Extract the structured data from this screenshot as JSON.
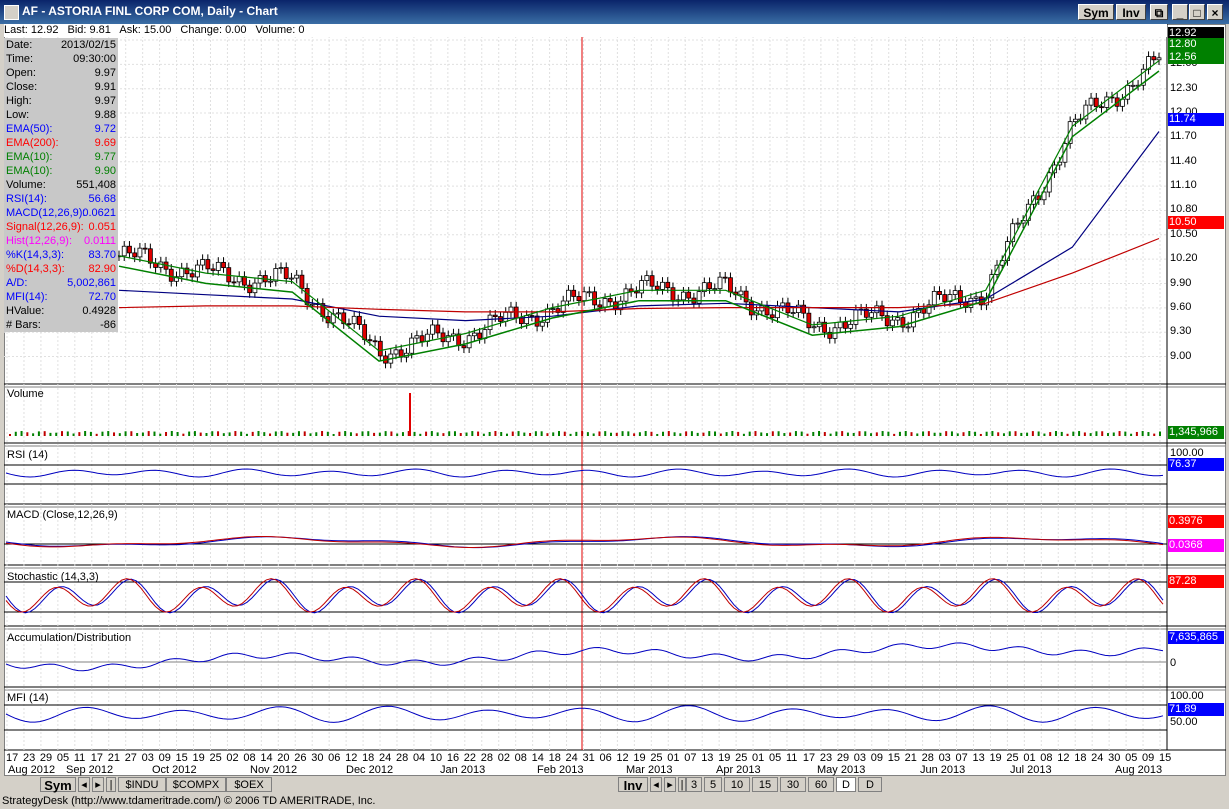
{
  "window": {
    "title": "AF - ASTORIA FINL CORP COM, Daily - Chart",
    "sym_label": "Sym",
    "inv_label": "Inv"
  },
  "header": {
    "last": "Last: 12.92",
    "bid": "Bid: 9.81",
    "ask": "Ask: 15.00",
    "change": "Change: 0.00",
    "volume": "Volume: 0"
  },
  "info_panel": [
    {
      "label": "Date:",
      "value": "2013/02/15",
      "color": "#000000"
    },
    {
      "label": "Time:",
      "value": "09:30:00",
      "color": "#000000"
    },
    {
      "label": "Open:",
      "value": "9.97",
      "color": "#000000"
    },
    {
      "label": "Close:",
      "value": "9.91",
      "color": "#000000"
    },
    {
      "label": "High:",
      "value": "9.97",
      "color": "#000000"
    },
    {
      "label": "Low:",
      "value": "9.88",
      "color": "#000000"
    },
    {
      "label": "EMA(50):",
      "value": "9.72",
      "color": "#0000ff"
    },
    {
      "label": "EMA(200):",
      "value": "9.69",
      "color": "#ff0000"
    },
    {
      "label": "EMA(10):",
      "value": "9.77",
      "color": "#008000"
    },
    {
      "label": "EMA(10):",
      "value": "9.90",
      "color": "#008000"
    },
    {
      "label": "Volume:",
      "value": "551,408",
      "color": "#000000"
    },
    {
      "label": "RSI(14):",
      "value": "56.68",
      "color": "#0000ff"
    },
    {
      "label": "MACD(12,26,9):",
      "value": "0.0621",
      "color": "#0000ff"
    },
    {
      "label": "Signal(12,26,9):",
      "value": "0.051",
      "color": "#ff0000"
    },
    {
      "label": "Hist(12,26,9):",
      "value": "0.0111",
      "color": "#ff00ff"
    },
    {
      "label": "%K(14,3,3):",
      "value": "83.70",
      "color": "#0000ff"
    },
    {
      "label": "%D(14,3,3):",
      "value": "82.90",
      "color": "#ff0000"
    },
    {
      "label": "A/D:",
      "value": "5,002,861",
      "color": "#0000ff"
    },
    {
      "label": "MFI(14):",
      "value": "72.70",
      "color": "#0000ff"
    },
    {
      "label": "HValue:",
      "value": "0.4928",
      "color": "#000000"
    },
    {
      "label": "# Bars:",
      "value": "-86",
      "color": "#000000"
    }
  ],
  "price_axis": {
    "ticks": [
      "12.90",
      "12.60",
      "12.30",
      "12.00",
      "11.70",
      "11.40",
      "11.10",
      "10.80",
      "10.50",
      "10.20",
      "9.90",
      "9.60",
      "9.30",
      "9.00"
    ],
    "tags": [
      {
        "text": "12.92",
        "bg": "#000000",
        "fg": "#ffffff"
      },
      {
        "text": "12.80",
        "bg": "#008000",
        "fg": "#ffffff"
      },
      {
        "text": "12.56",
        "bg": "#008000",
        "fg": "#ffffff"
      },
      {
        "text": "11.74",
        "bg": "#0000ff",
        "fg": "#ffffff"
      },
      {
        "text": "10.50",
        "bg": "#ff0000",
        "fg": "#ffffff"
      }
    ]
  },
  "panels": {
    "volume": {
      "title": "Volume",
      "tag": "1,345,966",
      "tag_bg": "#008000"
    },
    "rsi": {
      "title": "RSI (14)",
      "top": "100.00",
      "tag": "76.37",
      "tag_bg": "#0000ff"
    },
    "macd": {
      "title": "MACD (Close,12,26,9)",
      "tag": "0.3976",
      "tag_bg": "#ff0000",
      "tag2": "0.0368",
      "tag2_bg": "#ff00ff"
    },
    "stoch": {
      "title": "Stochastic (14,3,3)",
      "tag": "87.28",
      "tag_bg": "#ff0000"
    },
    "ad": {
      "title": "Accumulation/Distribution",
      "tag": "7,635,865",
      "tag_bg": "#0000ff",
      "zero": "0"
    },
    "mfi": {
      "title": "MFI (14)",
      "top": "100.00",
      "tag": "71.89",
      "tag_bg": "#0000ff",
      "mid": "50.00"
    }
  },
  "x_axis": {
    "days": [
      "17",
      "23",
      "29",
      "05",
      "11",
      "17",
      "21",
      "27",
      "03",
      "09",
      "15",
      "19",
      "25",
      "02",
      "08",
      "14",
      "20",
      "26",
      "30",
      "06",
      "12",
      "18",
      "24",
      "28",
      "04",
      "10",
      "16",
      "22",
      "28",
      "02",
      "08",
      "14",
      "18",
      "24",
      "31",
      "06",
      "12",
      "19",
      "25",
      "01",
      "07",
      "13",
      "19",
      "25",
      "01",
      "05",
      "11",
      "17",
      "23",
      "29",
      "03",
      "09",
      "15",
      "21",
      "28",
      "03",
      "07",
      "13",
      "19",
      "25",
      "01",
      "08",
      "12",
      "18",
      "24",
      "30",
      "05",
      "09",
      "15"
    ],
    "months": [
      "Aug 2012",
      "Sep 2012",
      "Oct 2012",
      "Nov 2012",
      "Dec 2012",
      "Jan 2013",
      "Feb 2013",
      "Mar 2013",
      "Apr 2013",
      "May 2013",
      "Jun 2013",
      "Jul 2013",
      "Aug 2013"
    ]
  },
  "bottom_tabs": {
    "left": [
      "Sym",
      "$INDU",
      "$COMPX",
      "$OEX"
    ],
    "right_inv": "Inv",
    "periods": [
      "3",
      "5",
      "10",
      "15",
      "30",
      "60",
      "D",
      "D"
    ]
  },
  "status": "StrategyDesk (http://www.tdameritrade.com/) © 2006 TD AMERITRADE, Inc.",
  "chart_data": {
    "type": "line",
    "title": "AF - ASTORIA FINL CORP COM, Daily - Chart",
    "x": [
      "2012-08",
      "2012-09",
      "2012-10",
      "2012-11",
      "2012-12",
      "2013-01",
      "2013-02",
      "2013-03",
      "2013-04",
      "2013-05",
      "2013-06",
      "2013-07",
      "2013-08"
    ],
    "series": [
      {
        "name": "EMA(50)",
        "values": [
          9.9,
          9.85,
          9.8,
          9.6,
          9.55,
          9.6,
          9.72,
          9.75,
          9.7,
          9.65,
          9.8,
          10.4,
          11.74
        ]
      },
      {
        "name": "EMA(200)",
        "values": [
          9.7,
          9.72,
          9.72,
          9.68,
          9.65,
          9.65,
          9.69,
          9.7,
          9.7,
          9.7,
          9.75,
          10.1,
          10.5
        ]
      },
      {
        "name": "EMA(10)",
        "values": [
          10.3,
          10.1,
          10.0,
          9.2,
          9.4,
          9.7,
          9.9,
          9.9,
          9.5,
          9.6,
          9.9,
          11.8,
          12.56
        ]
      }
    ],
    "ylim": [
      8.85,
      12.95
    ]
  }
}
